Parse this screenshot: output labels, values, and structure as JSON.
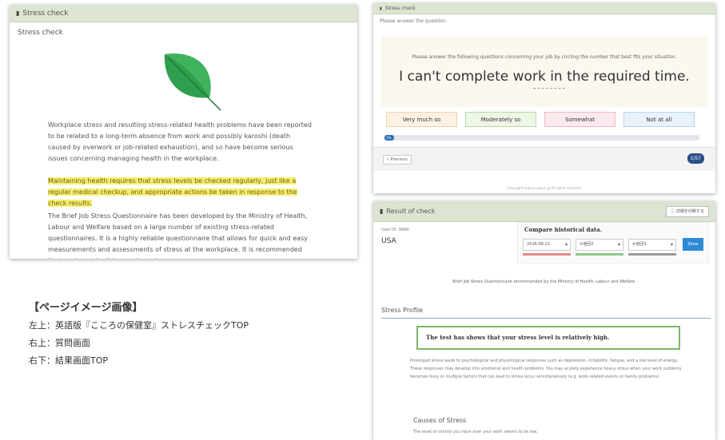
{
  "left_panel": {
    "header": "Stress check",
    "subtitle": "Stress check",
    "paragraph1": "Workplace stress and resulting stress-related health problems have been reported to be related to a long-term absence from work and possibly karoshi (death caused by overwork or job-related exhaustion), and so have become serious issues concerning managing health in the workplace.",
    "paragraph2": "Maintaining health requires that stress levels be checked regularly, just like a regular medical checkup, and appropriate actions be taken in response to the check results.",
    "paragraph3": "The Brief Job Stress Questionnaire has been developed by the Ministry of Health, Labour and Welfare based on a large number of existing stress-related questionnaires. It is a highly reliable questionnaire that allows for quick and easy measurements and assessments of stress at the workplace. It is recommended that workers take this questionnaire once a year.",
    "colors": {
      "leaf": "#2f9e4e",
      "highlight": "#f3ef6e"
    }
  },
  "question_panel": {
    "header": "Stress check",
    "prompt": "Please answer the question.",
    "instruction": "Please answer the following questions concerning your job by circling the number that best fits your situation.",
    "question": "I can't complete work in the required time.",
    "answers": [
      "Very much so",
      "Moderately so",
      "Somewhat",
      "Not at all"
    ],
    "progress_label": "1%",
    "progress_value": 0.03,
    "previous_label": "« Previous",
    "counter": "1/57",
    "copyright": "Copyright Appmanagers.jp All rights reserved."
  },
  "result_panel": {
    "header": "Result of check",
    "header_button": "ⓘ 詳細を印刷する",
    "user_id": "User ID: 9999",
    "country": "USA",
    "compare_title": "Compare historical data.",
    "selects": [
      "2016-06-22",
      "※他回2",
      "※他回3"
    ],
    "show_button": "Show",
    "brief_note": "Brief Job Stress Questionnaire recommended by the Ministry of Health, Labour and Welfare.",
    "section_title": "Stress Profile",
    "result_text": "The test has shows that your stress level is relatively high.",
    "body_text": "Prolonged stress leads to psychological and physiological responses such as depression, irritability, fatigue, and a low level of energy. These responses may develop into emotional and health problems. You may acutely experience heavy stress when your work suddenly becomes busy or multiple factors that can lead to stress occur simultaneously (e.g. work-related events or family problems).",
    "causes_title": "Causes of Stress",
    "control_text": "The level of control you have over your work seems to be low."
  },
  "captions": {
    "title": "【ページイメージ画像】",
    "line1": "左上：英語版『こころの保健室』ストレスチェックTOP",
    "line2": "右上：質問画面",
    "line3": "右下：結果画面TOP"
  }
}
